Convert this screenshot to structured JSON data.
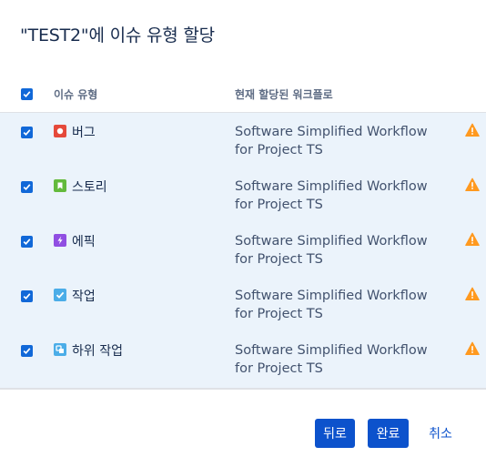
{
  "dialog": {
    "title": "\"TEST2\"에 이슈 유형 할당"
  },
  "table": {
    "headers": {
      "issue_type": "이슈 유형",
      "workflow": "현재 할당된 워크플로"
    },
    "rows": [
      {
        "type": "버그",
        "icon": "bug-icon",
        "icon_color": "#e5493a",
        "workflow": "Software Simplified Workflow for Project TS",
        "checked": true
      },
      {
        "type": "스토리",
        "icon": "story-icon",
        "icon_color": "#63ba3c",
        "workflow": "Software Simplified Workflow for Project TS",
        "checked": true
      },
      {
        "type": "에픽",
        "icon": "epic-icon",
        "icon_color": "#904ee2",
        "workflow": "Software Simplified Workflow for Project TS",
        "checked": true
      },
      {
        "type": "작업",
        "icon": "task-icon",
        "icon_color": "#4bade8",
        "workflow": "Software Simplified Workflow for Project TS",
        "checked": true
      },
      {
        "type": "하위 작업",
        "icon": "subtask-icon",
        "icon_color": "#4bade8",
        "workflow": "Software Simplified Workflow for Project TS",
        "checked": true
      }
    ]
  },
  "buttons": {
    "back": "뒤로",
    "finish": "완료",
    "cancel": "취소"
  },
  "colors": {
    "primary": "#0c52cc",
    "checkbox": "#1168d8",
    "warning": "#ff991f",
    "row_bg": "#ebf3fb"
  }
}
